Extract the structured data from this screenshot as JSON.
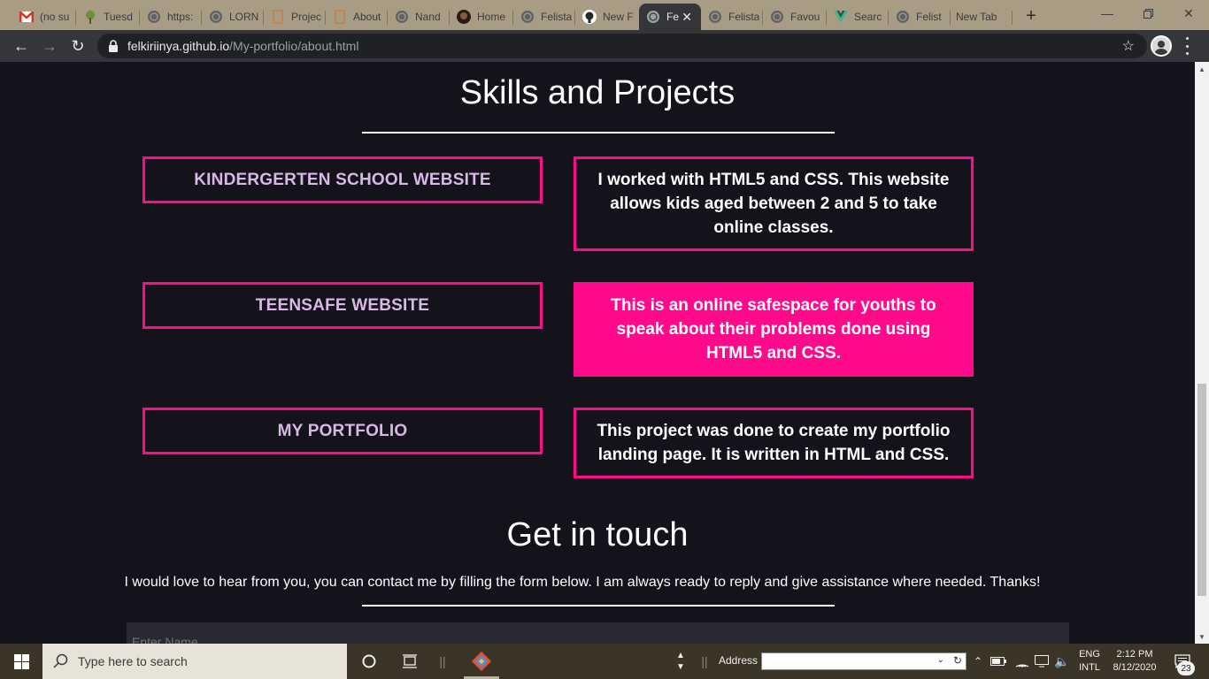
{
  "browser": {
    "tabs": [
      {
        "title": "(no su",
        "icon": "gmail-icon"
      },
      {
        "title": "Tuesd",
        "icon": "tree-icon"
      },
      {
        "title": "https:",
        "icon": "globe-icon"
      },
      {
        "title": "LORN",
        "icon": "globe-icon"
      },
      {
        "title": "Projec",
        "icon": "document-icon"
      },
      {
        "title": "About",
        "icon": "document-icon"
      },
      {
        "title": "Nand",
        "icon": "globe-icon"
      },
      {
        "title": "Home",
        "icon": "avatar-icon"
      },
      {
        "title": "Felista",
        "icon": "globe-icon"
      },
      {
        "title": "New F",
        "icon": "github-icon"
      },
      {
        "title": "Fe",
        "icon": "globe-icon",
        "active": true
      },
      {
        "title": "Felista",
        "icon": "globe-icon"
      },
      {
        "title": "Favou",
        "icon": "globe-icon"
      },
      {
        "title": "Searc",
        "icon": "vuejs-icon"
      },
      {
        "title": "Felist",
        "icon": "globe-icon"
      },
      {
        "title": "New Tab",
        "icon": ""
      }
    ],
    "url_host": "felkiriinya.github.io",
    "url_path": "/My-portfolio/about.html"
  },
  "page": {
    "skills_heading": "Skills and Projects",
    "projects": [
      {
        "name": "KINDERGERTEN SCHOOL WEBSITE",
        "description": "I worked with HTML5 and CSS. This website allows kids aged between 2 and 5 to take online classes.",
        "highlighted": false
      },
      {
        "name": "TEENSAFE WEBSITE",
        "description": "This is an online safespace for youths to speak about their problems done using HTML5 and CSS.",
        "highlighted": true
      },
      {
        "name": "MY PORTFOLIO",
        "description": "This project was done to create my portfolio landing page. It is written in HTML and CSS.",
        "highlighted": false
      }
    ],
    "contact_heading": "Get in touch",
    "contact_text": "I would love to hear from you, you can contact me by filling the form below. I am always ready to reply and give assistance where needed. Thanks!",
    "name_placeholder": "Enter Name"
  },
  "taskbar": {
    "search_placeholder": "Type here to search",
    "address_label": "Address",
    "lang_top": "ENG",
    "lang_bottom": "INTL",
    "time": "2:12 PM",
    "date": "8/12/2020",
    "notification_count": "23"
  },
  "colors": {
    "accent_pink": "#ff0a8b",
    "page_background": "#14121a",
    "project_label": "#d9b8e6"
  }
}
